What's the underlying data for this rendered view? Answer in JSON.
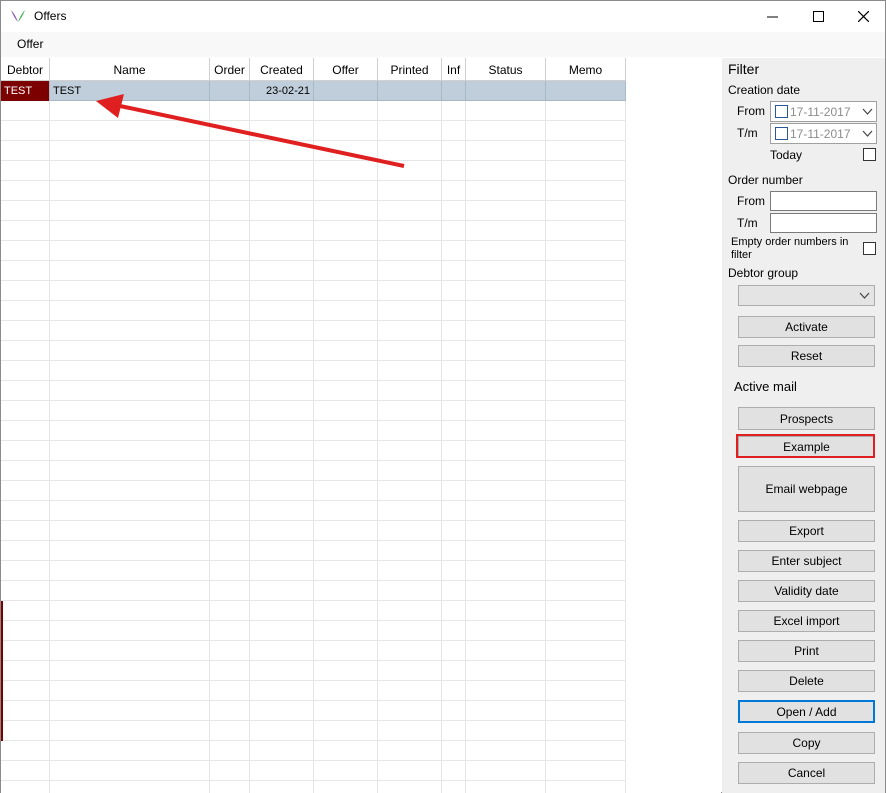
{
  "window": {
    "title": "Offers"
  },
  "menu": {
    "offer": "Offer"
  },
  "grid": {
    "columns": [
      "Debtor",
      "Name",
      "Order",
      "Created",
      "Offer",
      "Printed",
      "Inf",
      "Status",
      "Memo"
    ],
    "rows": [
      {
        "debtor": "TEST",
        "name": "TEST",
        "order": "",
        "created": "23-02-21",
        "offer": "",
        "printed": "",
        "inf": "",
        "status": "",
        "memo": ""
      }
    ]
  },
  "filter": {
    "heading": "Filter",
    "creation_date": "Creation date",
    "from": "From",
    "tm": "T/m",
    "from_date": "17-11-2017",
    "tm_date": "17-11-2017",
    "today": "Today",
    "order_number": "Order number",
    "order_from": "From",
    "order_tm": "T/m",
    "empty_order_line1": "Empty order numbers in",
    "empty_order_line2": "filter",
    "debtor_group": "Debtor group",
    "activate": "Activate",
    "reset": "Reset"
  },
  "active_mail": {
    "heading": "Active mail",
    "prospects": "Prospects",
    "example": "Example",
    "email_webpage": "Email webpage",
    "export": "Export",
    "enter_subject": "Enter subject",
    "validity_date": "Validity date",
    "excel_import": "Excel import",
    "print": "Print",
    "delete": "Delete",
    "open_add": "Open / Add",
    "copy": "Copy",
    "cancel": "Cancel"
  },
  "colors": {
    "selected_row": "#c0cedb",
    "debtor_highlight": "#7d0000",
    "annotation": "#e02020",
    "focus": "#0078d7"
  },
  "icons": [
    "app-logo-icon",
    "minimize-icon",
    "maximize-icon",
    "close-icon",
    "chevron-down-icon",
    "annotation-arrow-icon"
  ]
}
